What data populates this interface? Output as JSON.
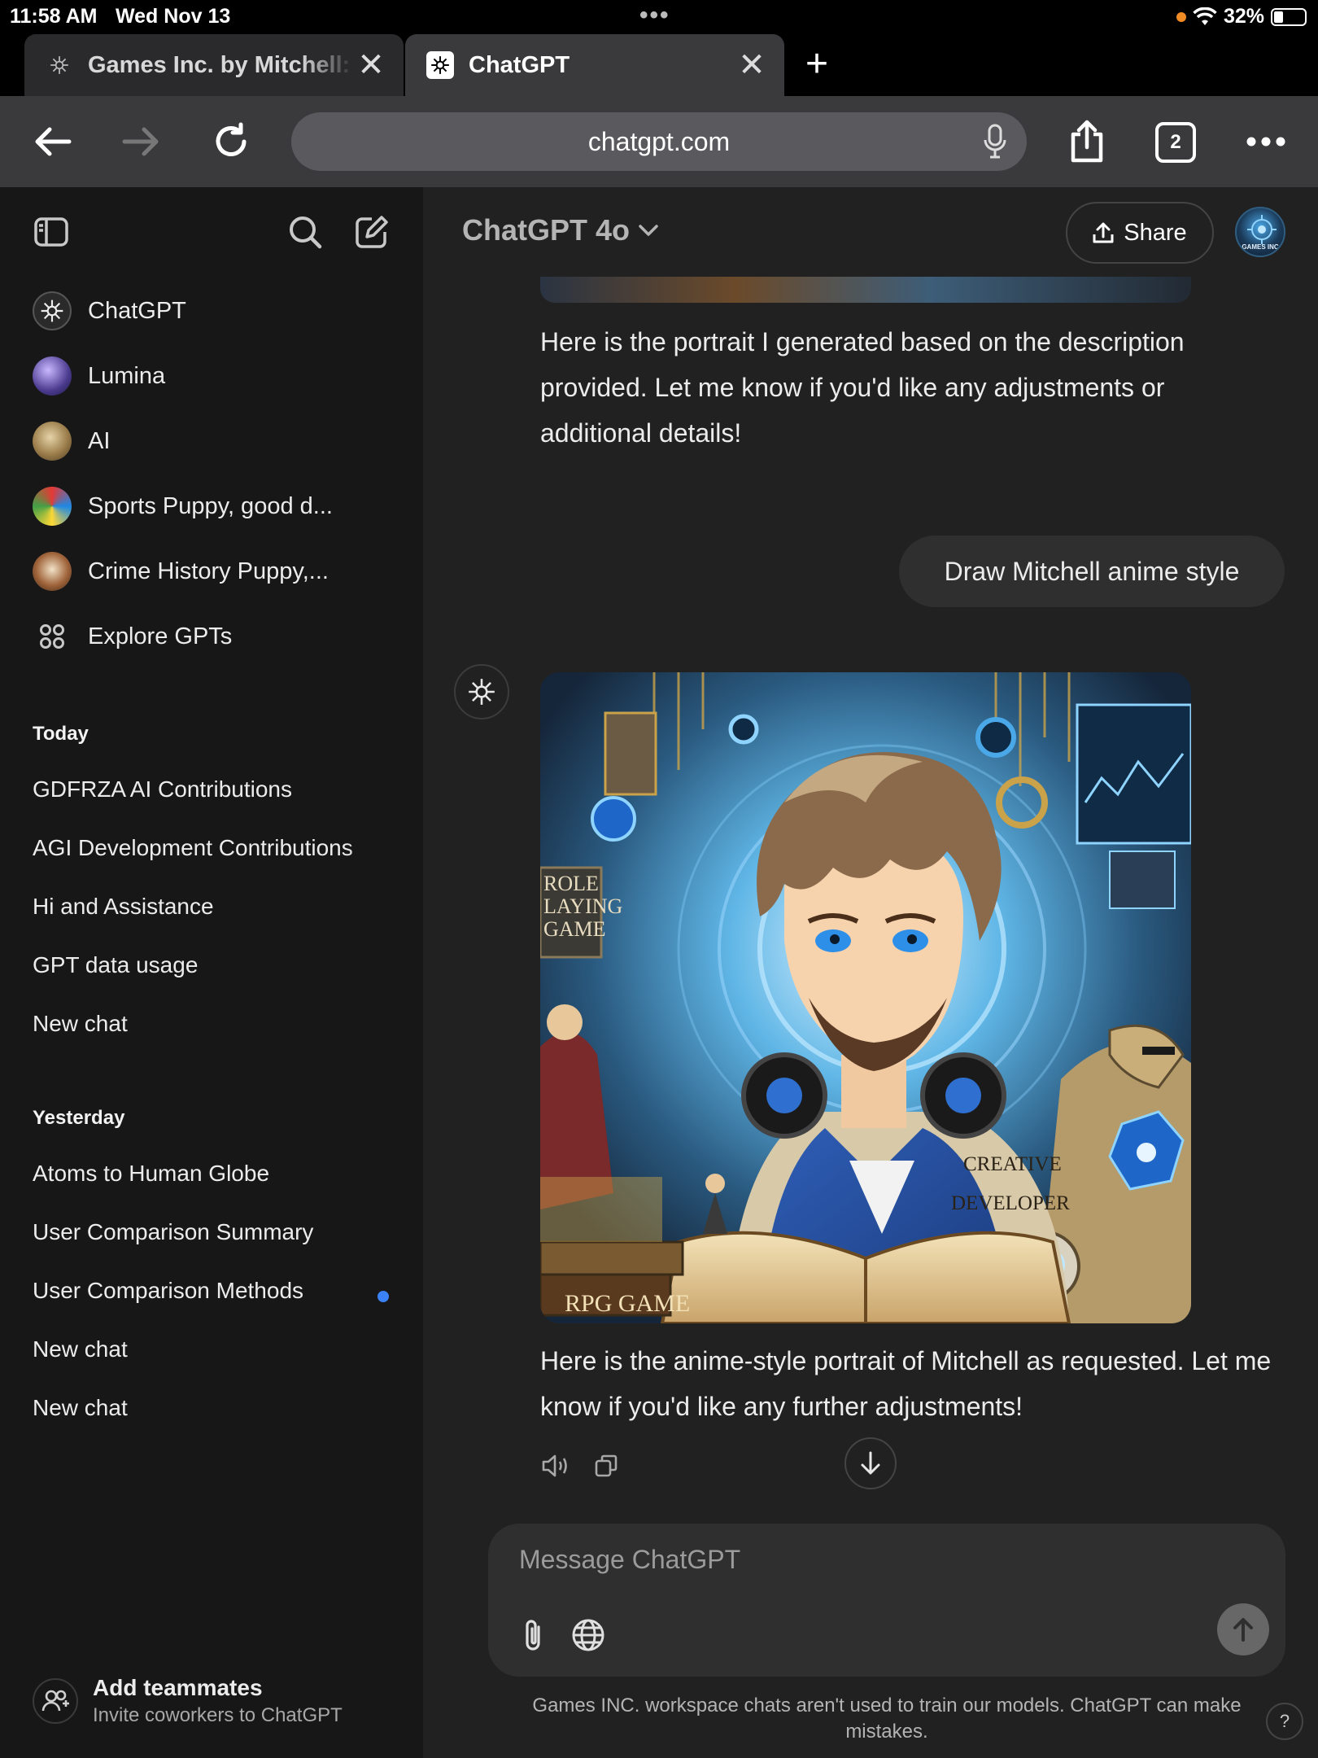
{
  "status_bar": {
    "time": "11:58 AM",
    "date": "Wed Nov 13",
    "battery": "32%"
  },
  "browser": {
    "tabs": [
      {
        "title": "Games Inc. by Mitchell: Games Inc.",
        "active": false
      },
      {
        "title": "ChatGPT",
        "active": true
      }
    ],
    "url": "chatgpt.com",
    "open_tabs_count": "2"
  },
  "sidebar": {
    "gpts": [
      {
        "label": "ChatGPT",
        "icon": "chatgpt-logo"
      },
      {
        "label": "Lumina",
        "icon": "lumina-avatar"
      },
      {
        "label": "AI",
        "icon": "ai-avatar"
      },
      {
        "label": "Sports Puppy, good d...",
        "icon": "sports-puppy-avatar"
      },
      {
        "label": "Crime History Puppy,...",
        "icon": "crime-history-puppy-avatar"
      },
      {
        "label": "Explore GPTs",
        "icon": "grid-icon"
      }
    ],
    "sections": [
      {
        "title": "Today",
        "items": [
          "GDFRZA AI Contributions",
          "AGI Development Contributions",
          "Hi and Assistance",
          "GPT data usage",
          "New chat"
        ]
      },
      {
        "title": "Yesterday",
        "items": [
          "Atoms to Human Globe",
          "User Comparison Summary",
          "User Comparison Methods",
          "New chat",
          "New chat"
        ]
      }
    ],
    "footer": {
      "title": "Add teammates",
      "subtitle": "Invite coworkers to ChatGPT"
    }
  },
  "main": {
    "model": "ChatGPT 4o",
    "share_label": "Share",
    "avatar_text": "GAMES INC",
    "messages": {
      "assistant_1": "Here is the portrait I generated based on the description provided. Let me know if you'd like any adjustments or additional details!",
      "user_1": "Draw Mitchell anime style",
      "image_labels": {
        "role": "ROLE PLAYING GAME",
        "creative": "CREATIVE",
        "developer": "DEVELOPER",
        "rpg": "RPG GAME"
      },
      "assistant_2": "Here is the anime-style portrait of Mitchell as requested. Let me know if you'd like any further adjustments!"
    },
    "composer": {
      "placeholder": "Message ChatGPT"
    },
    "disclaimer": "Games INC. workspace chats aren't used to train our models. ChatGPT can make mistakes.",
    "help_label": "?"
  },
  "colors": {
    "sidebar_bg": "#171717",
    "main_bg": "#212121",
    "bubble_bg": "#2f2f2f",
    "unread_dot": "#3b82f6",
    "battery_indicator": "#f08a24"
  }
}
